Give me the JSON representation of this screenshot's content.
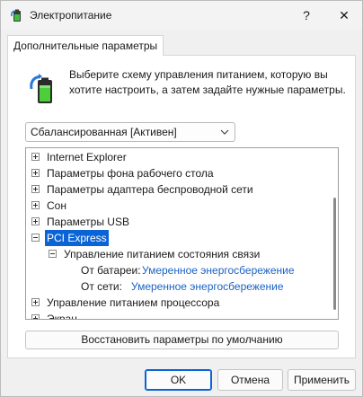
{
  "window": {
    "title": "Электропитание",
    "help_glyph": "?",
    "close_glyph": "✕"
  },
  "tab": {
    "label": "Дополнительные параметры"
  },
  "description": "Выберите схему управления питанием, которую вы хотите настроить, а затем задайте нужные параметры.",
  "scheme": {
    "selected": "Сбалансированная [Активен]"
  },
  "tree": {
    "items": [
      {
        "label": "Internet Explorer",
        "expander": "+"
      },
      {
        "label": "Параметры фона рабочего стола",
        "expander": "+"
      },
      {
        "label": "Параметры адаптера беспроводной сети",
        "expander": "+"
      },
      {
        "label": "Сон",
        "expander": "+"
      },
      {
        "label": "Параметры USB",
        "expander": "+"
      },
      {
        "label": "PCI Express",
        "expander": "−",
        "selected": true
      },
      {
        "label": "Управление питанием состояния связи",
        "expander": "−"
      },
      {
        "label": "Управление питанием процессора",
        "expander": "+"
      },
      {
        "label": "Экран",
        "expander": "+"
      }
    ],
    "settings": [
      {
        "key": "От батареи:",
        "value": "Умеренное энергосбережение"
      },
      {
        "key": "От сети:",
        "value": "Умеренное энергосбережение"
      }
    ]
  },
  "buttons": {
    "restore": "Восстановить параметры по умолчанию",
    "ok": "OK",
    "cancel": "Отмена",
    "apply": "Применить"
  },
  "colors": {
    "accent": "#0a64d6",
    "link": "#1a62c4"
  }
}
